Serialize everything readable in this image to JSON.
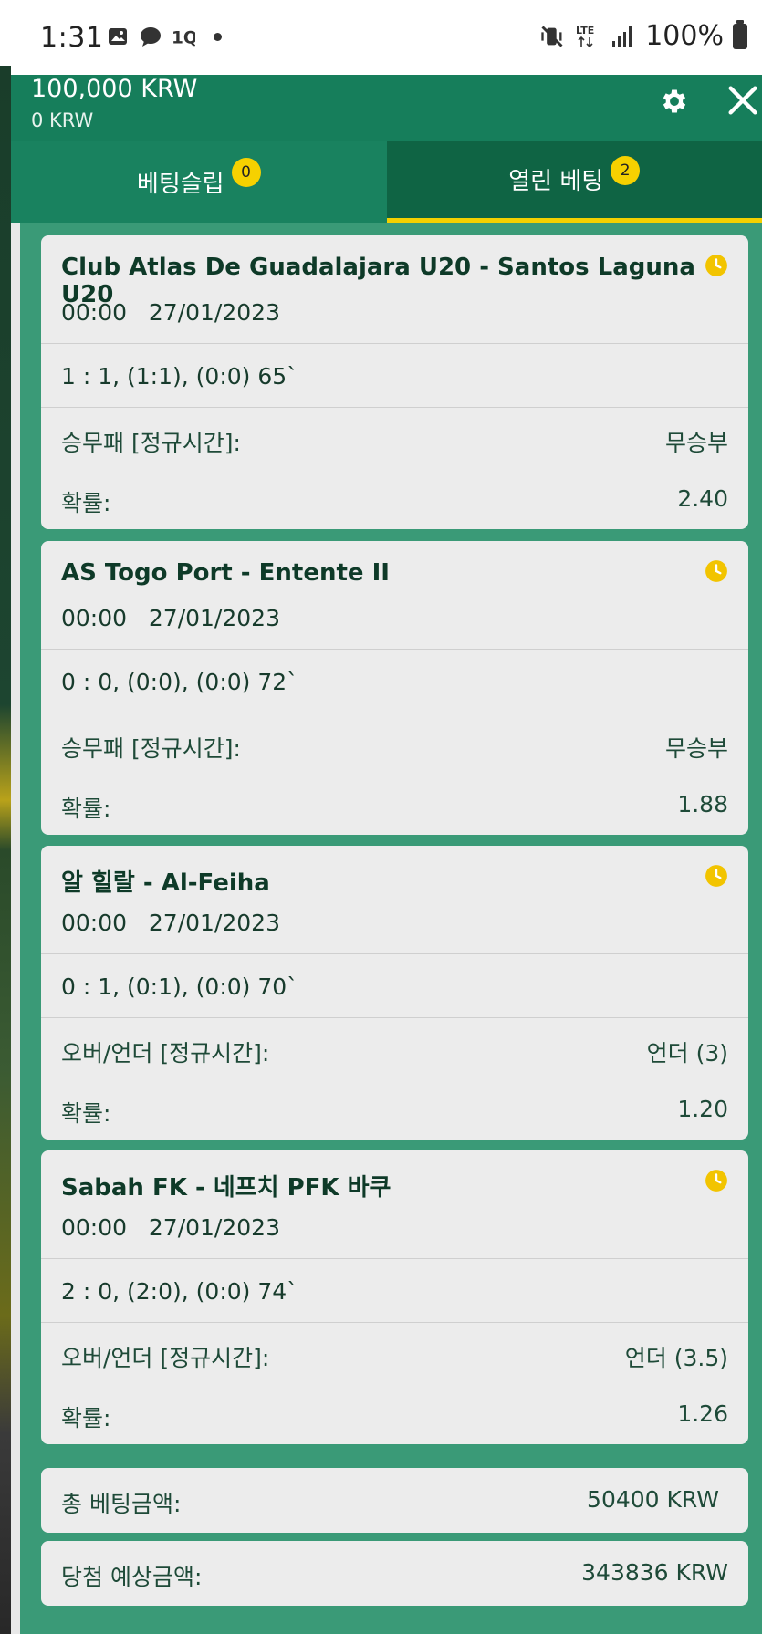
{
  "status": {
    "time": "1:31",
    "network": "LTE",
    "battery": "100%"
  },
  "header": {
    "balance": "100,000 KRW",
    "bonus": "0 KRW"
  },
  "tabs": [
    {
      "label": "베팅슬립",
      "count": "0"
    },
    {
      "label": "열린 베팅",
      "count": "2"
    }
  ],
  "bets": [
    {
      "match": "Club Atlas De Guadalajara U20 - Santos Laguna U20",
      "time": "00:00",
      "date": "27/01/2023",
      "score": "1 : 1, (1:1), (0:0) 65`",
      "market": "승무패 [정규시간]:",
      "selection": "무승부",
      "odds_label": "확률:",
      "odds": "2.40"
    },
    {
      "match": "AS Togo Port - Entente II",
      "time": "00:00",
      "date": "27/01/2023",
      "score": "0 : 0, (0:0), (0:0) 72`",
      "market": "승무패 [정규시간]:",
      "selection": "무승부",
      "odds_label": "확률:",
      "odds": "1.88"
    },
    {
      "match": "알 힐랄 - Al-Feiha",
      "time": "00:00",
      "date": "27/01/2023",
      "score": "0 : 1, (0:1), (0:0) 70`",
      "market": "오버/언더 [정규시간]:",
      "selection": "언더 (3)",
      "odds_label": "확률:",
      "odds": "1.20"
    },
    {
      "match": "Sabah FK - 네프치 PFK 바쿠",
      "time": "00:00",
      "date": "27/01/2023",
      "score": "2 : 0, (2:0), (0:0) 74`",
      "market": "오버/언더 [정규시간]:",
      "selection": "언더 (3.5)",
      "odds_label": "확률:",
      "odds": "1.26"
    }
  ],
  "summary": {
    "total_label": "총 베팅금액:",
    "total_value": "50400 KRW",
    "win_label": "당첨 예상금액:",
    "win_value": "343836 KRW"
  },
  "colors": {
    "panel": "#167e5b",
    "content_bg": "#3a9a77",
    "tab_active_bg": "#0f6444",
    "accent_yellow": "#f4d000",
    "card": "#ececec"
  }
}
